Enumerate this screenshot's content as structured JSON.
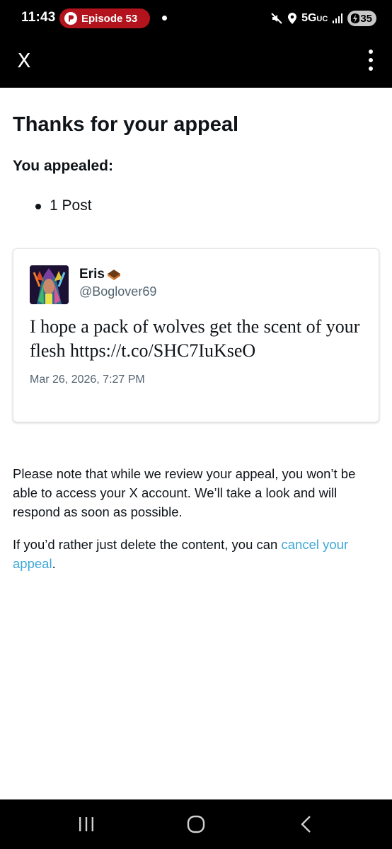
{
  "status_bar": {
    "time": "11:43",
    "media_pill_label": "Episode 53",
    "network_label": "5G",
    "network_suffix": "UC",
    "battery_level": "35",
    "media_pill_color": "#b2131c"
  },
  "app_bar": {
    "close_label": "X",
    "more_icon": "more-vertical-icon"
  },
  "page": {
    "title": "Thanks for your appeal",
    "appealed_label": "You appealed:",
    "appealed_items": [
      "1 Post"
    ]
  },
  "post": {
    "author_name": "Eris",
    "author_handle": "@Boglover69",
    "text": "I hope a pack of wolves get the scent of your flesh https://t.co/SHC7IuKseO",
    "date": "Mar 26, 2026, 7:27 PM"
  },
  "notice": {
    "review_note": "Please note that while we review your appeal, you won’t be able to access your X account. We’ll take a look and will respond as soon as possible.",
    "cancel_prefix": "If you’d rather just delete the content, you can ",
    "cancel_link": "cancel your appeal",
    "cancel_suffix": "."
  },
  "colors": {
    "link": "#3ea7d8",
    "secondary_text": "#536471",
    "bar_background": "#000000"
  }
}
